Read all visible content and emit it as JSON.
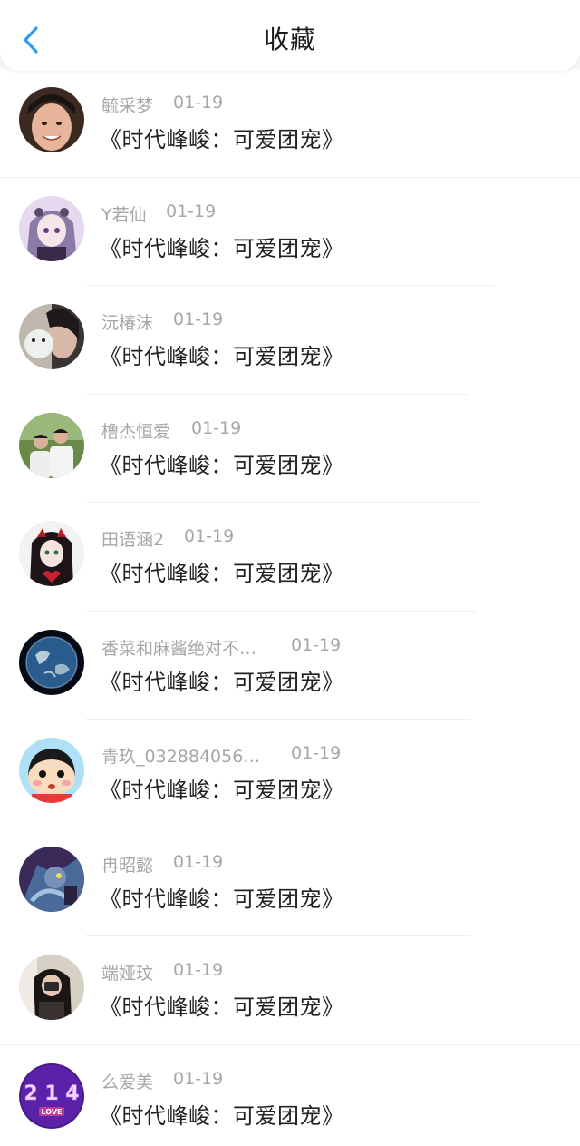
{
  "header": {
    "title": "收藏",
    "back_icon": "chevron-left-icon",
    "accent_color": "#2e9cf2"
  },
  "favorites": [
    {
      "user": "毓采梦",
      "date": "01-19",
      "work": "《时代峰峻：可爱团宠》",
      "avatar": "avatar-photo-boy"
    },
    {
      "user": "Y若仙",
      "date": "01-19",
      "work": "《时代峰峻：可爱团宠》",
      "avatar": "avatar-anime-girl"
    },
    {
      "user": "沅椿沫",
      "date": "01-19",
      "work": "《时代峰峻：可爱团宠》",
      "avatar": "avatar-photo-plush"
    },
    {
      "user": "橹杰恒爱",
      "date": "01-19",
      "work": "《时代峰峻：可爱团宠》",
      "avatar": "avatar-photo-two-boys"
    },
    {
      "user": "田语涵2",
      "date": "01-19",
      "work": "《时代峰峻：可爱团宠》",
      "avatar": "avatar-anime-red"
    },
    {
      "user": "香菜和麻酱绝对不…",
      "date": "01-19",
      "work": "《时代峰峻：可爱团宠》",
      "avatar": "avatar-earth"
    },
    {
      "user": "青玖_032884056…",
      "date": "01-19",
      "work": "《时代峰峻：可爱团宠》",
      "avatar": "avatar-cartoon-boy"
    },
    {
      "user": "冉昭懿",
      "date": "01-19",
      "work": "《时代峰峻：可爱团宠》",
      "avatar": "avatar-game-character"
    },
    {
      "user": "端娅玟",
      "date": "01-19",
      "work": "《时代峰峻：可爱团宠》",
      "avatar": "avatar-photo-girl"
    },
    {
      "user": "么爱美",
      "date": "01-19",
      "work": "《时代峰峻：可爱团宠》",
      "avatar": "avatar-purple-214-love",
      "avatar_text": "2 1 4",
      "avatar_subtext": "LOVE"
    }
  ]
}
